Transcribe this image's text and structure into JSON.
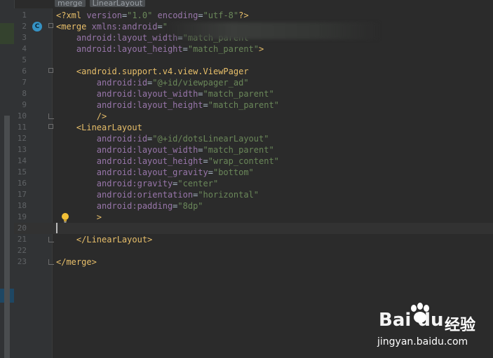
{
  "breadcrumbs": [
    "merge",
    "LinearLayout"
  ],
  "gutter_badge": "C",
  "current_line": 20,
  "lines": [
    {
      "n": "1",
      "parts": [
        [
          "tag",
          "<?xml "
        ],
        [
          "attr",
          "version"
        ],
        [
          "txt",
          "="
        ],
        [
          "val",
          "\"1.0\""
        ],
        [
          "txt",
          " "
        ],
        [
          "attr",
          "encoding"
        ],
        [
          "txt",
          "="
        ],
        [
          "val",
          "\"utf-8\""
        ],
        [
          "tag",
          "?>"
        ]
      ]
    },
    {
      "n": "2",
      "parts": [
        [
          "tag",
          "<merge "
        ],
        [
          "attr",
          "xmlns:android"
        ],
        [
          "txt",
          "="
        ],
        [
          "val",
          "\""
        ]
      ]
    },
    {
      "n": "3",
      "parts": [
        [
          "txt",
          "    "
        ],
        [
          "attr",
          "android:layout_width"
        ],
        [
          "txt",
          "="
        ],
        [
          "val",
          "\"match_parent"
        ]
      ]
    },
    {
      "n": "4",
      "parts": [
        [
          "txt",
          "    "
        ],
        [
          "attr",
          "android:layout_height"
        ],
        [
          "txt",
          "="
        ],
        [
          "val",
          "\"match_parent\""
        ],
        [
          "tag",
          ">"
        ]
      ]
    },
    {
      "n": "5",
      "parts": []
    },
    {
      "n": "6",
      "parts": [
        [
          "txt",
          "    "
        ],
        [
          "tag",
          "<android.support.v4.view.ViewPager"
        ]
      ]
    },
    {
      "n": "7",
      "parts": [
        [
          "txt",
          "        "
        ],
        [
          "attr",
          "android:id"
        ],
        [
          "txt",
          "="
        ],
        [
          "val",
          "\"@+id/viewpager_ad\""
        ]
      ]
    },
    {
      "n": "8",
      "parts": [
        [
          "txt",
          "        "
        ],
        [
          "attr",
          "android:layout_width"
        ],
        [
          "txt",
          "="
        ],
        [
          "val",
          "\"match_parent\""
        ]
      ]
    },
    {
      "n": "9",
      "parts": [
        [
          "txt",
          "        "
        ],
        [
          "attr",
          "android:layout_height"
        ],
        [
          "txt",
          "="
        ],
        [
          "val",
          "\"match_parent\""
        ]
      ]
    },
    {
      "n": "10",
      "parts": [
        [
          "txt",
          "        "
        ],
        [
          "tag",
          "/>"
        ]
      ]
    },
    {
      "n": "11",
      "parts": [
        [
          "txt",
          "    "
        ],
        [
          "tag",
          "<LinearLayout"
        ]
      ]
    },
    {
      "n": "12",
      "parts": [
        [
          "txt",
          "        "
        ],
        [
          "attr",
          "android:id"
        ],
        [
          "txt",
          "="
        ],
        [
          "val",
          "\"@+id/dotsLinearLayout\""
        ]
      ]
    },
    {
      "n": "13",
      "parts": [
        [
          "txt",
          "        "
        ],
        [
          "attr",
          "android:layout_width"
        ],
        [
          "txt",
          "="
        ],
        [
          "val",
          "\"match_parent\""
        ]
      ]
    },
    {
      "n": "14",
      "parts": [
        [
          "txt",
          "        "
        ],
        [
          "attr",
          "android:layout_height"
        ],
        [
          "txt",
          "="
        ],
        [
          "val",
          "\"wrap_content\""
        ]
      ]
    },
    {
      "n": "15",
      "parts": [
        [
          "txt",
          "        "
        ],
        [
          "attr",
          "android:layout_gravity"
        ],
        [
          "txt",
          "="
        ],
        [
          "val",
          "\"bottom\""
        ]
      ]
    },
    {
      "n": "16",
      "parts": [
        [
          "txt",
          "        "
        ],
        [
          "attr",
          "android:gravity"
        ],
        [
          "txt",
          "="
        ],
        [
          "val",
          "\"center\""
        ]
      ]
    },
    {
      "n": "17",
      "parts": [
        [
          "txt",
          "        "
        ],
        [
          "attr",
          "android:orientation"
        ],
        [
          "txt",
          "="
        ],
        [
          "val",
          "\"horizontal\""
        ]
      ]
    },
    {
      "n": "18",
      "parts": [
        [
          "txt",
          "        "
        ],
        [
          "attr",
          "android:padding"
        ],
        [
          "txt",
          "="
        ],
        [
          "val",
          "\"8dp\""
        ]
      ]
    },
    {
      "n": "19",
      "parts": [
        [
          "txt",
          "        "
        ],
        [
          "tag",
          ">"
        ]
      ]
    },
    {
      "n": "20",
      "parts": []
    },
    {
      "n": "21",
      "parts": [
        [
          "txt",
          "    "
        ],
        [
          "tag",
          "</LinearLayout>"
        ]
      ]
    },
    {
      "n": "22",
      "parts": []
    },
    {
      "n": "23",
      "parts": [
        [
          "tag",
          "</merge>"
        ]
      ]
    }
  ],
  "watermark": {
    "logo": "Bai du",
    "brand": "经验",
    "url": "jingyan.baidu.com"
  },
  "colors": {
    "background": "#2b2b2b",
    "tag": "#e8bf6a",
    "attribute": "#9876aa",
    "value": "#6a8759",
    "line_number": "#606366",
    "badge": "#3592c4"
  }
}
